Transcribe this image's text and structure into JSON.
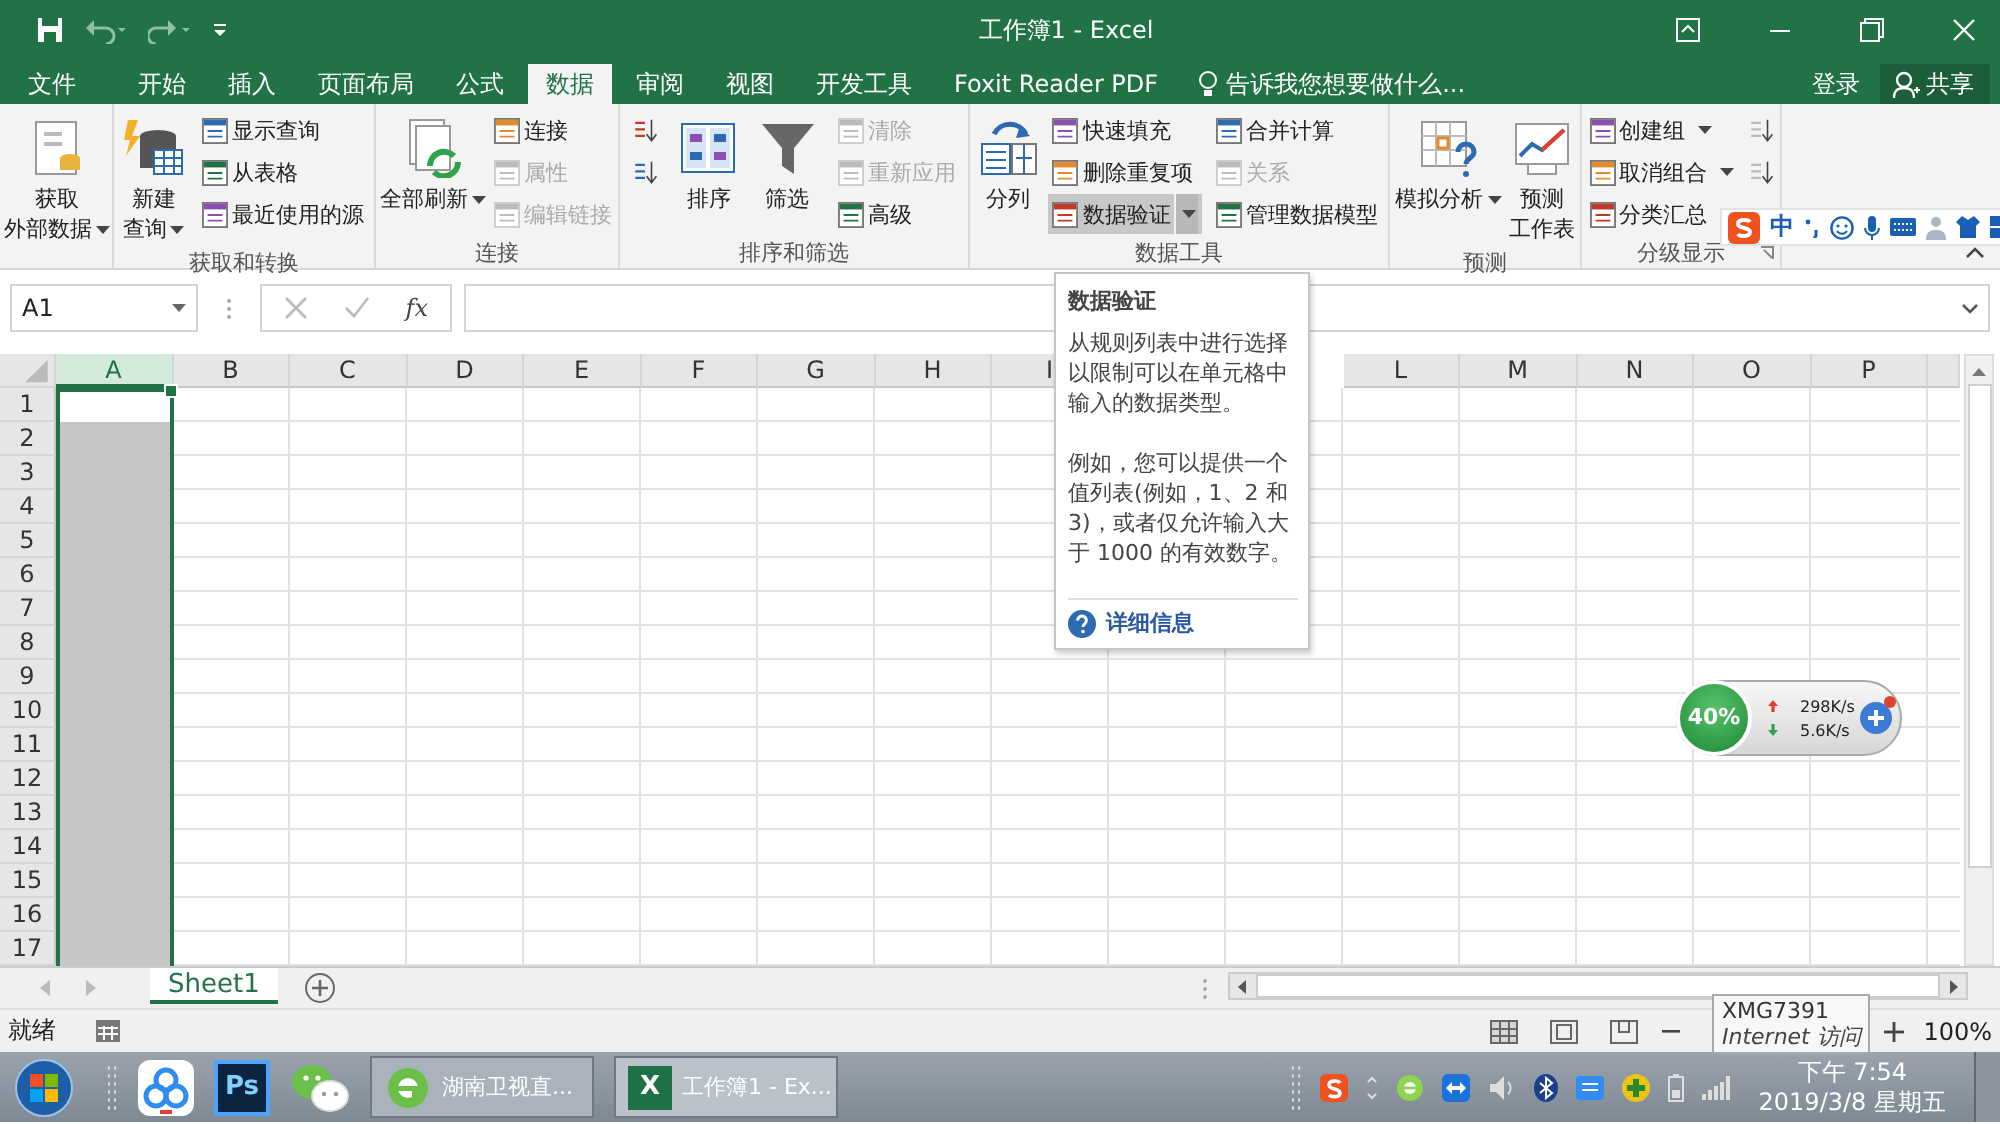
{
  "title_bar": {
    "title": "工作簿1 - Excel"
  },
  "tabs": [
    {
      "label": "文件",
      "selected": false
    },
    {
      "label": "开始",
      "selected": false
    },
    {
      "label": "插入",
      "selected": false
    },
    {
      "label": "页面布局",
      "selected": false
    },
    {
      "label": "公式",
      "selected": false
    },
    {
      "label": "数据",
      "selected": true
    },
    {
      "label": "审阅",
      "selected": false
    },
    {
      "label": "视图",
      "selected": false
    },
    {
      "label": "开发工具",
      "selected": false
    },
    {
      "label": "Foxit Reader PDF",
      "selected": false
    }
  ],
  "tell_me": {
    "placeholder": "告诉我您想要做什么..."
  },
  "account": {
    "sign_in": "登录",
    "share": "共享"
  },
  "ribbon": {
    "groups": [
      {
        "columns": [
          {
            "kind": "large",
            "lines": [
              "获取",
              "外部数据"
            ],
            "dropdown": true
          }
        ]
      },
      {
        "label": "获取和转换",
        "columns": [
          {
            "kind": "large",
            "lines": [
              "新建",
              "查询"
            ],
            "dropdown": true
          },
          {
            "kind": "stack",
            "items": [
              {
                "label": "显示查询",
                "disabled": false,
                "highlighted": false
              },
              {
                "label": "从表格",
                "disabled": false,
                "highlighted": false
              },
              {
                "label": "最近使用的源",
                "disabled": false,
                "highlighted": false
              }
            ]
          }
        ]
      },
      {
        "label": "连接",
        "columns": [
          {
            "kind": "large",
            "label": "全部刷新",
            "dropdown": true
          },
          {
            "kind": "stack",
            "items": [
              {
                "label": "连接",
                "disabled": false,
                "highlighted": false
              },
              {
                "label": "属性",
                "disabled": true,
                "highlighted": false
              },
              {
                "label": "编辑链接",
                "disabled": true,
                "highlighted": false
              }
            ]
          }
        ]
      },
      {
        "label": "排序和筛选",
        "columns": [
          {
            "kind": "stack",
            "items": [
              {
                "disabled": false,
                "highlighted": false
              },
              {
                "disabled": false,
                "highlighted": false
              }
            ]
          },
          {
            "kind": "large",
            "label": "排序"
          },
          {
            "kind": "large",
            "label": "筛选"
          },
          {
            "kind": "stack",
            "items": [
              {
                "label": "清除",
                "disabled": true,
                "highlighted": false
              },
              {
                "label": "重新应用",
                "disabled": true,
                "highlighted": false
              },
              {
                "label": "高级",
                "disabled": false,
                "highlighted": false
              }
            ]
          }
        ]
      },
      {
        "label": "数据工具",
        "columns": [
          {
            "kind": "large",
            "label": "分列"
          },
          {
            "kind": "stack",
            "items": [
              {
                "label": "快速填充",
                "disabled": false,
                "highlighted": false
              },
              {
                "label": "删除重复项",
                "disabled": false,
                "highlighted": false
              },
              {
                "label": "数据验证",
                "disabled": false,
                "highlighted": true,
                "dropdown": true
              }
            ]
          },
          {
            "kind": "stack",
            "items": [
              {
                "label": "合并计算",
                "disabled": false,
                "highlighted": false
              },
              {
                "label": "关系",
                "disabled": true,
                "highlighted": false
              },
              {
                "label": "管理数据模型",
                "disabled": false,
                "highlighted": false
              }
            ]
          }
        ]
      },
      {
        "label": "预测",
        "columns": [
          {
            "kind": "large",
            "label": "模拟分析",
            "dropdown": true
          },
          {
            "kind": "large",
            "lines": [
              "预测",
              "工作表"
            ]
          }
        ]
      },
      {
        "label": "分级显示",
        "launcher": true,
        "columns": [
          {
            "kind": "stack",
            "items": [
              {
                "label": "创建组",
                "disabled": false,
                "highlighted": false,
                "dropdown": true
              },
              {
                "label": "取消组合",
                "disabled": false,
                "highlighted": false,
                "dropdown": true
              },
              {
                "label": "分类汇总",
                "disabled": false,
                "highlighted": false
              }
            ]
          },
          {
            "kind": "stack",
            "items": [
              {
                "disabled": true,
                "highlighted": false
              },
              {
                "disabled": true,
                "highlighted": false
              }
            ]
          }
        ]
      }
    ]
  },
  "formula_bar": {
    "name_box": "A1",
    "fx": "fx"
  },
  "tooltip": {
    "title": "数据验证",
    "paragraphs": [
      "从规则列表中进行选择以限制可以在单元格中输入的数据类型。",
      "例如，您可以提供一个值列表(例如，1、2 和 3)，或者仅允许输入大于 1000 的有效数字。"
    ],
    "link": "详细信息"
  },
  "grid": {
    "columns": [
      {
        "label": "A",
        "selected": true
      },
      {
        "label": "B",
        "selected": false
      },
      {
        "label": "C",
        "selected": false
      },
      {
        "label": "D",
        "selected": false
      },
      {
        "label": "E",
        "selected": false
      },
      {
        "label": "F",
        "selected": false
      },
      {
        "label": "G",
        "selected": false
      },
      {
        "label": "H",
        "selected": false
      },
      {
        "label": "I",
        "selected": false
      },
      {
        "label": "L",
        "selected": false
      },
      {
        "label": "M",
        "selected": false
      },
      {
        "label": "N",
        "selected": false
      },
      {
        "label": "O",
        "selected": false
      },
      {
        "label": "P",
        "selected": false
      }
    ],
    "rows": [
      "1",
      "2",
      "3",
      "4",
      "5",
      "6",
      "7",
      "8",
      "9",
      "10",
      "11",
      "12",
      "13",
      "14",
      "15",
      "16",
      "17"
    ]
  },
  "sheet_tabs": [
    {
      "label": "Sheet1",
      "selected": true
    }
  ],
  "status_bar": {
    "status": "就绪",
    "zoom": "100%"
  },
  "network_popup": {
    "network": "XMG7391",
    "access": "Internet 访问"
  },
  "speed_widget": {
    "percent": "40%",
    "upload": "298K/s",
    "download": "5.6K/s"
  },
  "ime_bar": {
    "mode": "中"
  },
  "taskbar": {
    "ps_label": "Ps",
    "tasks": [
      {
        "label": "湖南卫视直...",
        "selected": false
      },
      {
        "label": "工作簿1 - Ex...",
        "selected": true,
        "icon_text": "X"
      }
    ],
    "time": "下午 7:54",
    "date": "2019/3/8 星期五"
  }
}
